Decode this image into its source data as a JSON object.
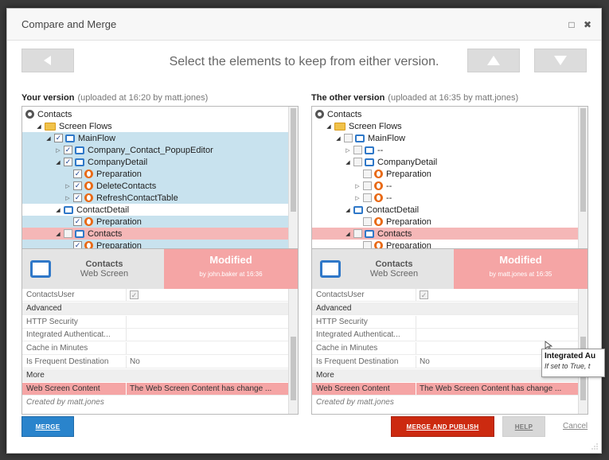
{
  "window": {
    "title": "Compare and Merge"
  },
  "nav": {
    "prompt": "Select the elements to keep from either version."
  },
  "left": {
    "heading": "Your version",
    "subheading": "(uploaded at 16:20 by matt.jones)",
    "tree": [
      {
        "label": "Contacts",
        "indent": 0,
        "twisty": "",
        "checkbox": "",
        "icon": "app-icon",
        "highlight": ""
      },
      {
        "label": "Screen Flows",
        "indent": 1,
        "twisty": "open",
        "checkbox": "",
        "icon": "folder-icon",
        "highlight": ""
      },
      {
        "label": "MainFlow",
        "indent": 2,
        "twisty": "open",
        "checkbox": "on",
        "icon": "screen-icon",
        "highlight": "blue"
      },
      {
        "label": "Company_Contact_PopupEditor",
        "indent": 3,
        "twisty": "closed",
        "checkbox": "on",
        "icon": "screen-icon",
        "highlight": "blue"
      },
      {
        "label": "CompanyDetail",
        "indent": 3,
        "twisty": "open",
        "checkbox": "on",
        "icon": "screen-icon",
        "highlight": "blue"
      },
      {
        "label": "Preparation",
        "indent": 4,
        "twisty": "",
        "checkbox": "on",
        "icon": "action-icon",
        "highlight": "blue"
      },
      {
        "label": "DeleteContacts",
        "indent": 4,
        "twisty": "closed",
        "checkbox": "on",
        "icon": "action-icon",
        "highlight": "blue"
      },
      {
        "label": "RefreshContactTable",
        "indent": 4,
        "twisty": "closed",
        "checkbox": "on",
        "icon": "action-icon",
        "highlight": "blue"
      },
      {
        "label": "ContactDetail",
        "indent": 3,
        "twisty": "open",
        "checkbox": "",
        "icon": "screen-icon",
        "highlight": ""
      },
      {
        "label": "Preparation",
        "indent": 4,
        "twisty": "",
        "checkbox": "on",
        "icon": "action-icon",
        "highlight": "blue"
      },
      {
        "label": "Contacts",
        "indent": 3,
        "twisty": "open",
        "checkbox": "off",
        "icon": "screen-icon",
        "highlight": "red"
      },
      {
        "label": "Preparation",
        "indent": 4,
        "twisty": "",
        "checkbox": "on",
        "icon": "action-icon",
        "highlight": "blue"
      }
    ],
    "info": {
      "name": "Contacts",
      "type": "Web Screen",
      "status": "Modified",
      "by": "by john.baker at 16:36"
    },
    "props": [
      {
        "key": "ContactsUser",
        "value": "",
        "kind": "check"
      },
      {
        "key": "Advanced",
        "value": "",
        "kind": "section"
      },
      {
        "key": "HTTP Security",
        "value": "",
        "kind": "row"
      },
      {
        "key": "Integrated Authenticat...",
        "value": "",
        "kind": "row"
      },
      {
        "key": "Cache in Minutes",
        "value": "",
        "kind": "row"
      },
      {
        "key": "Is Frequent Destination",
        "value": "No",
        "kind": "row"
      },
      {
        "key": "More",
        "value": "",
        "kind": "section"
      },
      {
        "key": "Web Screen Content",
        "value": "The Web Screen Content has change ...",
        "kind": "diff"
      },
      {
        "key": "Created by matt.jones",
        "value": "",
        "kind": "footer"
      }
    ]
  },
  "right": {
    "heading": "The other version",
    "subheading": "(uploaded at 16:35 by matt.jones)",
    "tree": [
      {
        "label": "Contacts",
        "indent": 0,
        "twisty": "",
        "checkbox": "",
        "icon": "app-icon",
        "highlight": ""
      },
      {
        "label": "Screen Flows",
        "indent": 1,
        "twisty": "open",
        "checkbox": "",
        "icon": "folder-icon",
        "highlight": ""
      },
      {
        "label": "MainFlow",
        "indent": 2,
        "twisty": "open",
        "checkbox": "off",
        "icon": "screen-icon",
        "highlight": ""
      },
      {
        "label": "--",
        "indent": 3,
        "twisty": "closed",
        "checkbox": "off",
        "icon": "screen-icon",
        "highlight": ""
      },
      {
        "label": "CompanyDetail",
        "indent": 3,
        "twisty": "open",
        "checkbox": "off",
        "icon": "screen-icon",
        "highlight": ""
      },
      {
        "label": "Preparation",
        "indent": 4,
        "twisty": "",
        "checkbox": "off",
        "icon": "action-icon",
        "highlight": ""
      },
      {
        "label": "--",
        "indent": 4,
        "twisty": "closed",
        "checkbox": "off",
        "icon": "action-icon",
        "highlight": ""
      },
      {
        "label": "--",
        "indent": 4,
        "twisty": "closed",
        "checkbox": "off",
        "icon": "action-icon",
        "highlight": ""
      },
      {
        "label": "ContactDetail",
        "indent": 3,
        "twisty": "open",
        "checkbox": "",
        "icon": "screen-icon",
        "highlight": ""
      },
      {
        "label": "Preparation",
        "indent": 4,
        "twisty": "",
        "checkbox": "off",
        "icon": "action-icon",
        "highlight": ""
      },
      {
        "label": "Contacts",
        "indent": 3,
        "twisty": "open",
        "checkbox": "off",
        "icon": "screen-icon",
        "highlight": "red"
      },
      {
        "label": "Preparation",
        "indent": 4,
        "twisty": "",
        "checkbox": "off",
        "icon": "action-icon",
        "highlight": ""
      }
    ],
    "info": {
      "name": "Contacts",
      "type": "Web Screen",
      "status": "Modified",
      "by": "by matt.jones at 16:35"
    },
    "props": [
      {
        "key": "ContactsUser",
        "value": "",
        "kind": "check"
      },
      {
        "key": "Advanced",
        "value": "",
        "kind": "section"
      },
      {
        "key": "HTTP Security",
        "value": "",
        "kind": "row"
      },
      {
        "key": "Integrated Authenticat...",
        "value": "",
        "kind": "row"
      },
      {
        "key": "Cache in Minutes",
        "value": "",
        "kind": "row"
      },
      {
        "key": "Is Frequent Destination",
        "value": "No",
        "kind": "row"
      },
      {
        "key": "More",
        "value": "",
        "kind": "section"
      },
      {
        "key": "Web Screen Content",
        "value": "The Web Screen Content has change ...",
        "kind": "diff"
      },
      {
        "key": "Created by matt.jones",
        "value": "",
        "kind": "footer"
      }
    ]
  },
  "tooltip": {
    "title": "Integrated Au",
    "text": "If set to True, t"
  },
  "buttons": {
    "merge": "MERGE",
    "merge_publish": "MERGE AND PUBLISH",
    "help": "HELP",
    "cancel": "Cancel"
  },
  "colors": {
    "blue_highlight": "#c8e2ee",
    "red_highlight": "#f5b7b7",
    "merge_button": "#2a84cc",
    "merge_publish_button": "#cc2a10",
    "modified": "#f5a5a5"
  }
}
